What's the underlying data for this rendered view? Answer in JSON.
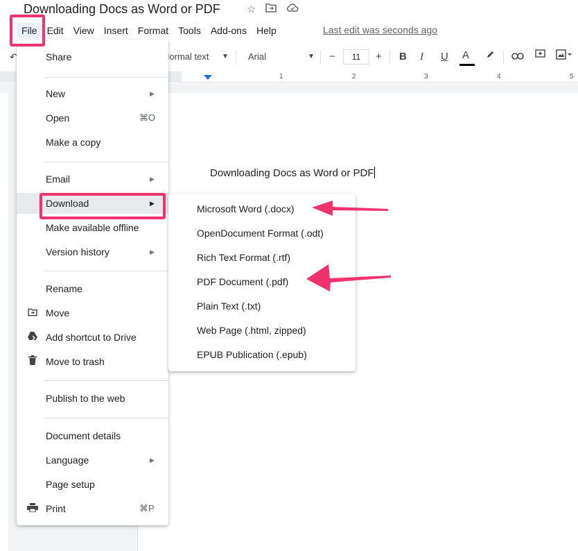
{
  "doc": {
    "title": "Downloading Docs as Word or PDF",
    "body_text": "Downloading Docs as Word or PDF"
  },
  "title_icons": [
    "star-icon",
    "move-to-folder-icon",
    "cloud-status-icon"
  ],
  "menubar": {
    "items": [
      "File",
      "Edit",
      "View",
      "Insert",
      "Format",
      "Tools",
      "Add-ons",
      "Help"
    ],
    "last_edit": "Last edit was seconds ago"
  },
  "toolbar": {
    "style": "Normal text",
    "font": "Arial",
    "font_size": "11",
    "minus": "−",
    "plus": "+",
    "bold": "B",
    "italic": "I",
    "underline": "U",
    "text_color": "A"
  },
  "ruler": {
    "numbers": [
      "1",
      "2",
      "3",
      "4",
      "5"
    ]
  },
  "file_menu": {
    "share": "Share",
    "new": "New",
    "open": "Open",
    "open_shortcut": "⌘O",
    "make_copy": "Make a copy",
    "email": "Email",
    "download": "Download",
    "offline": "Make available offline",
    "version_history": "Version history",
    "rename": "Rename",
    "move": "Move",
    "add_shortcut": "Add shortcut to Drive",
    "trash": "Move to trash",
    "publish": "Publish to the web",
    "details": "Document details",
    "language": "Language",
    "page_setup": "Page setup",
    "print": "Print",
    "print_shortcut": "⌘P"
  },
  "download_menu": {
    "items": [
      "Microsoft Word (.docx)",
      "OpenDocument Format (.odt)",
      "Rich Text Format (.rtf)",
      "PDF Document (.pdf)",
      "Plain Text (.txt)",
      "Web Page (.html, zipped)",
      "EPUB Publication (.epub)"
    ]
  },
  "colors": {
    "annotation": "#f0336f",
    "accent": "#1a73e8"
  }
}
